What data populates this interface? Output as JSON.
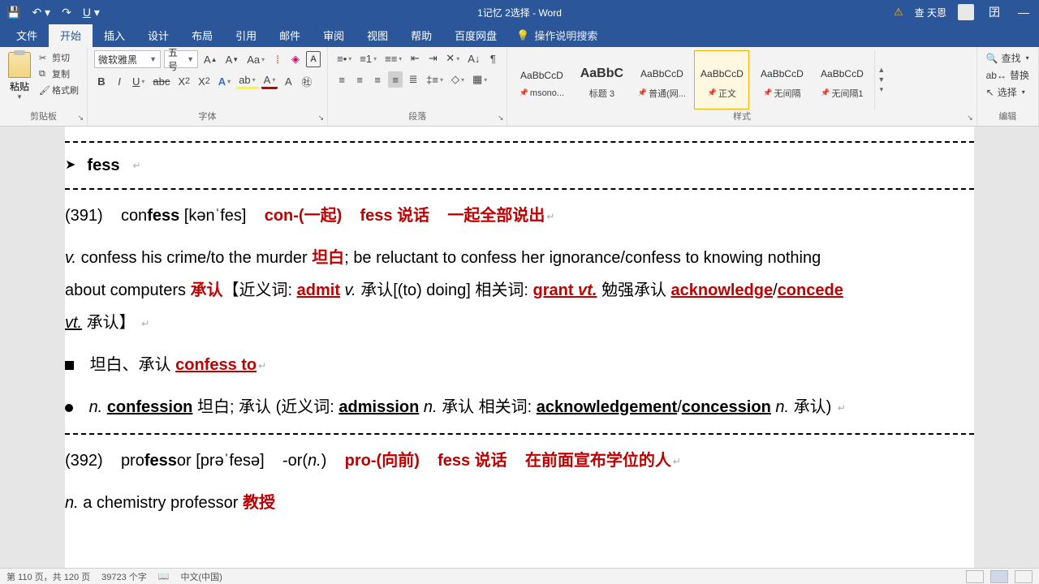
{
  "titlebar": {
    "title": "1记忆 2选择 - Word",
    "user": "查 天恩",
    "ribbon_display": "囝"
  },
  "tabs": {
    "file": "文件",
    "home": "开始",
    "insert": "插入",
    "design": "设计",
    "layout": "布局",
    "references": "引用",
    "mailings": "邮件",
    "review": "审阅",
    "view": "视图",
    "help": "帮助",
    "baidu": "百度网盘",
    "tellme": "操作说明搜索"
  },
  "clipboard": {
    "paste": "粘贴",
    "cut": "剪切",
    "copy": "复制",
    "format_painter": "格式刷",
    "label": "剪贴板"
  },
  "font": {
    "name": "微软雅黑",
    "size": "五号",
    "label": "字体"
  },
  "paragraph": {
    "label": "段落"
  },
  "styles": {
    "label": "样式",
    "items": [
      {
        "preview": "AaBbCcD",
        "name": "msono..."
      },
      {
        "preview": "AaBbC",
        "name": "标题 3"
      },
      {
        "preview": "AaBbCcD",
        "name": "普通(网..."
      },
      {
        "preview": "AaBbCcD",
        "name": "正文"
      },
      {
        "preview": "AaBbCcD",
        "name": "无间隔"
      },
      {
        "preview": "AaBbCcD",
        "name": "无间隔1"
      }
    ]
  },
  "editing": {
    "find": "查找",
    "replace": "替换",
    "select": "选择",
    "label": "编辑"
  },
  "status": {
    "page": "第 110 页，共 120 页",
    "words": "39723 个字",
    "lang": "中文(中国)"
  },
  "doc": {
    "root_head": "fess",
    "e391": {
      "num": "(391)",
      "word_pre": "con",
      "word_bold": "fess",
      "phon": " [kənˈfes]",
      "r1": "con-(一起)",
      "r2": "fess 说话",
      "r3": "一起全部说出"
    },
    "body1": {
      "p1a": "v.",
      "p1b": " confess his crime/to the murder ",
      "p1c": "坦白",
      "p1d": "; ",
      "p1sel": " ",
      "p1e": "be reluctant to confess her ignorance/confess to knowing nothing",
      "p2a": "about computers ",
      "p2b": "承认",
      "p2c": "【近义词: ",
      "p2d": "admit",
      "p2e": " v.",
      "p2f": " 承认[(to) doing] 相关词: ",
      "p2g": "grant",
      "p2h": " vt.",
      "p2i": " 勉强承认 ",
      "p2j": "acknowledge",
      "p2k": "/",
      "p2l": "concede",
      "p3a": "vt.",
      "p3b": " 承认】"
    },
    "bullet1": {
      "t1": "坦白、承认 ",
      "t2": "confess to"
    },
    "bullet2": {
      "t1": "n. ",
      "t2": "confession",
      "t3": " 坦白; 承认 (近义词: ",
      "t4": "admission",
      "t5": " n.",
      "t6": " 承认 相关词: ",
      "t7": "acknowledgement",
      "t8": "/",
      "t9": "concession",
      "t10": " n.",
      "t11": " 承认)"
    },
    "e392": {
      "num": "(392)",
      "w1": "pro",
      "w2": "fess",
      "w3": "or",
      "phon": " [prəˈfesə]",
      "r0": "-or(n.)",
      "r1": "pro-(向前)",
      "r2": "fess 说话",
      "r3": "在前面宣布学位的人"
    },
    "body2": {
      "a": "n.",
      "b": " a chemistry professor ",
      "c": "教授"
    }
  }
}
